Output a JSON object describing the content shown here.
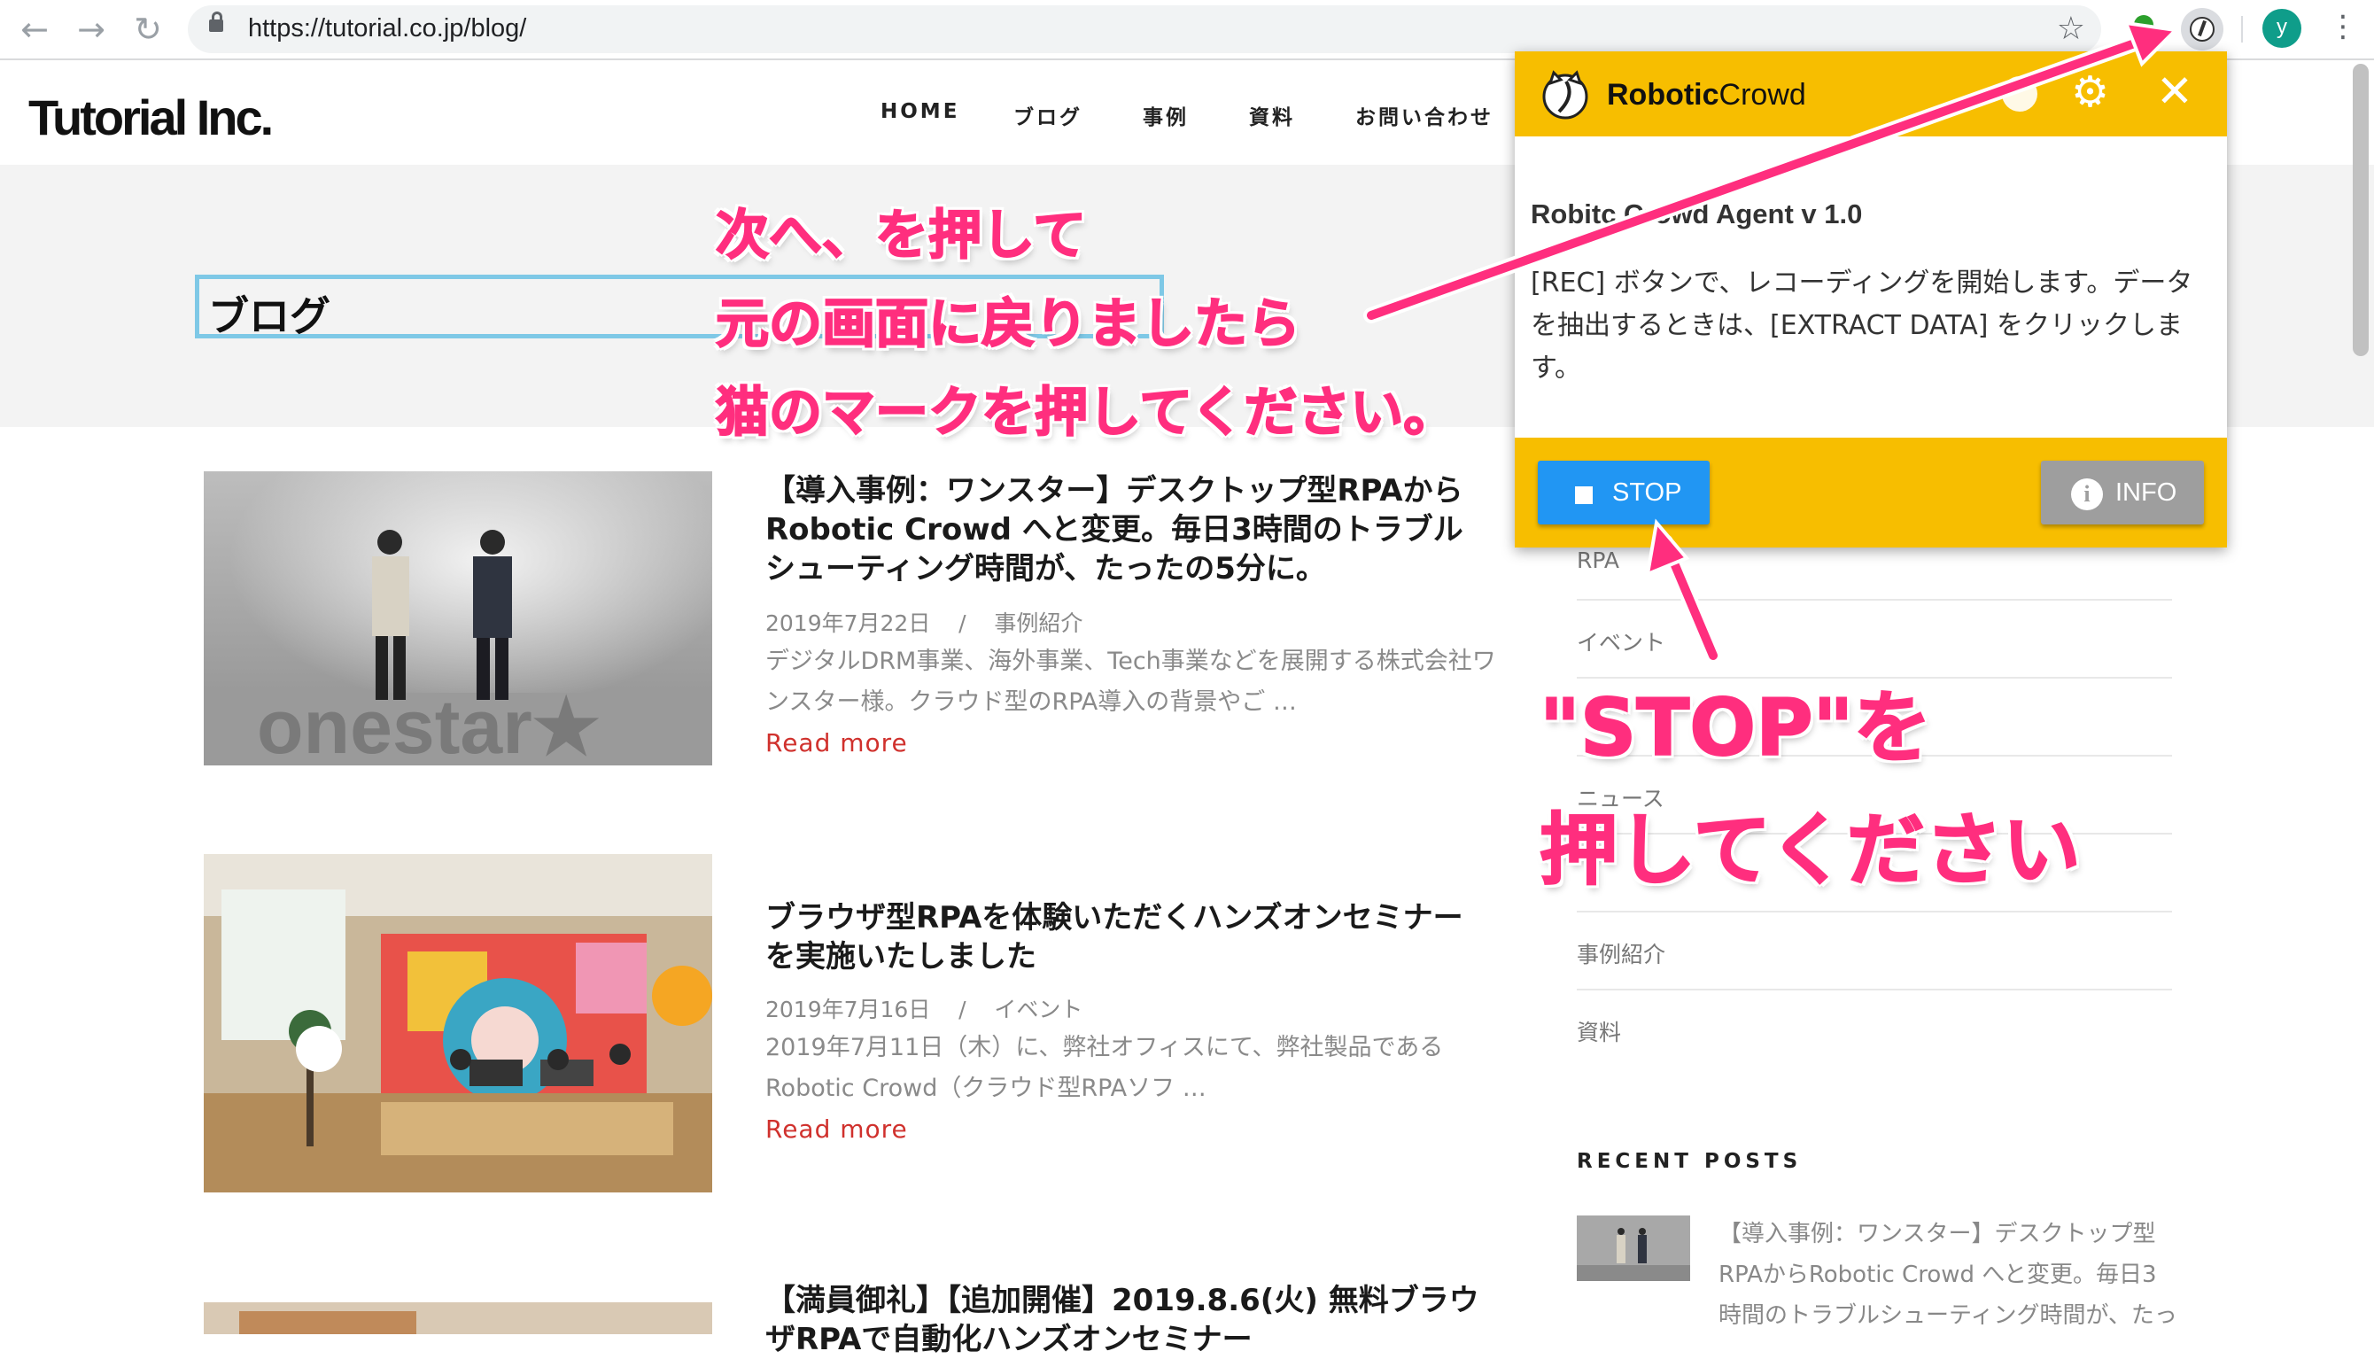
{
  "browser": {
    "url": "https://tutorial.co.jp/blog/",
    "profile_initial": "y"
  },
  "site": {
    "logo": "Tutorial Inc.",
    "nav": [
      "HOME",
      "ブログ",
      "事例",
      "資料",
      "お問い合わせ"
    ]
  },
  "page": {
    "title": "ブログ"
  },
  "posts": [
    {
      "title": "【導入事例：ワンスター】デスクトップ型RPAからRobotic Crowd へと変更。毎日3時間のトラブルシューティング時間が、たったの5分に。",
      "date": "2019年7月22日",
      "separator": "/",
      "category": "事例紹介",
      "excerpt": "デジタルDRM事業、海外事業、Tech事業などを展開する株式会社ワンスター様。クラウド型のRPA導入の背景やご …",
      "read_more": "Read more"
    },
    {
      "title": "ブラウザ型RPAを体験いただくハンズオンセミナーを実施いたしました",
      "date": "2019年7月16日",
      "separator": "/",
      "category": "イベント",
      "excerpt": "2019年7月11日（木）に、弊社オフィスにて、弊社製品であるRobotic Crowd（クラウド型RPAソフ …",
      "read_more": "Read more"
    },
    {
      "title": "【満員御礼】【追加開催】2019.8.6(火) 無料ブラウザRPAで自動化ハンズオンセミナー"
    }
  ],
  "sidebar": {
    "categories": [
      "RPA",
      "イベント",
      "",
      "ニュース",
      "",
      "事例紹介",
      "資料"
    ],
    "recent_heading": "RECENT POSTS",
    "recent_post": "【導入事例：ワンスター】デスクトップ型RPAからRobotic Crowd へと変更。毎日3時間のトラブルシューティング時間が、たっ"
  },
  "popup": {
    "brand_bold": "Robotic",
    "brand_light": "Crowd",
    "title": "Robitc Crowd Agent v 1.0",
    "description": "[REC] ボタンで、レコーディングを開始します。データを抽出するときは、[EXTRACT DATA] をクリックします。",
    "stop_label": "STOP",
    "info_label": "INFO"
  },
  "annotations": {
    "top": [
      "次へ、を押して",
      "元の画面に戻りましたら",
      "猫のマークを押してください。"
    ],
    "bottom": [
      "\"STOP\"を",
      "押してください"
    ]
  },
  "colors": {
    "popup_bg": "#f7be00",
    "stop_button": "#2196f3",
    "info_button": "#9e9e9e",
    "annotation": "#ff2e7e",
    "read_more": "#d0312d",
    "title_highlight": "#7ec8e6"
  }
}
